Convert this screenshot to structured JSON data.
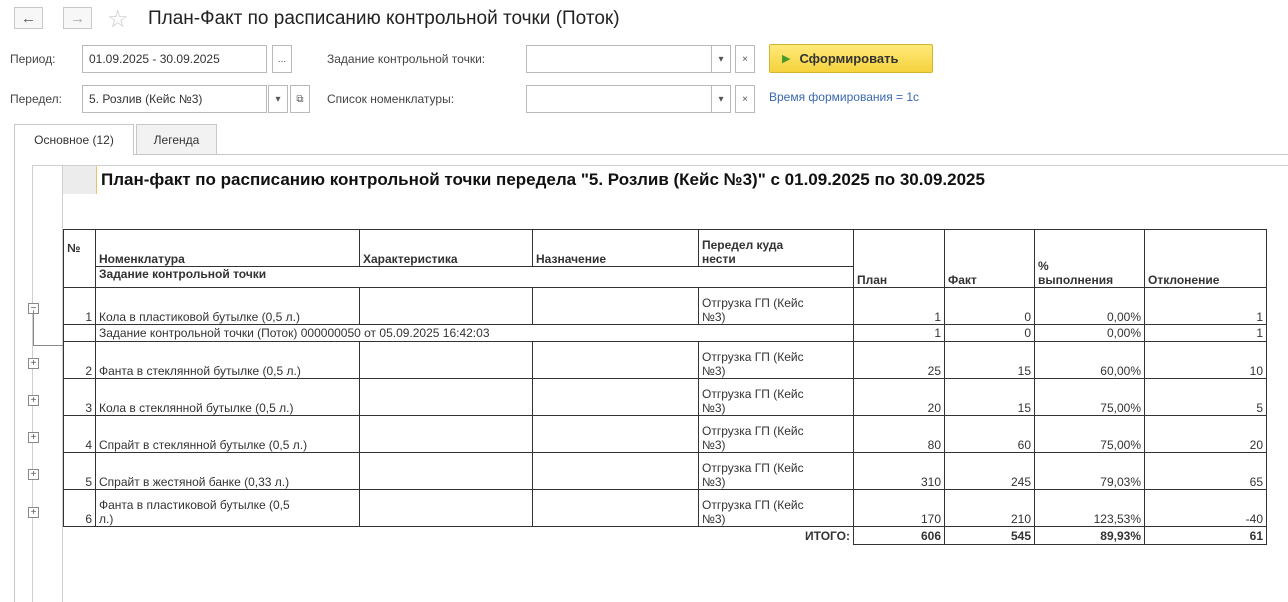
{
  "window": {
    "title": "План-Факт по расписанию контрольной точки (Поток)",
    "back_icon": "←",
    "forward_icon": "→",
    "star_icon": "☆"
  },
  "form": {
    "period_label": "Период:",
    "period_value": "01.09.2025 - 30.09.2025",
    "period_button": "...",
    "task_label": "Задание контрольной точки:",
    "task_value": "",
    "generate_button": "Сформировать",
    "peredel_label": "Передел:",
    "peredel_value": "5. Розлив (Кейс №3)",
    "nomenclature_label": "Список номенклатуры:",
    "nomenclature_value": "",
    "time_info": "Время формирования = 1с",
    "dropdown_icon": "▾",
    "clear_icon": "×",
    "open_icon": "⧉"
  },
  "tabs": [
    {
      "label": "Основное (12)"
    },
    {
      "label": "Легенда"
    }
  ],
  "report": {
    "title": "План-факт по расписанию контрольной точки передела \"5. Розлив (Кейс №3)\" с 01.09.2025 по 30.09.2025",
    "headers": {
      "num": "№",
      "nomenclature": "Номенклатура",
      "task": "Задание контрольной точки",
      "characteristic": "Характеристика",
      "purpose": "Назначение",
      "peredel_to_1": "Передел куда",
      "peredel_to_2": "нести",
      "plan": "План",
      "fact": "Факт",
      "percent_1": "%",
      "percent_2": "выполнения",
      "deviation": "Отклонение"
    },
    "rows": [
      {
        "num": "1",
        "name": "Кола в пластиковой бутылке (0,5 л.)",
        "dest1": "Отгрузка ГП (Кейс",
        "dest2": "№3)",
        "plan": "1",
        "fact": "0",
        "percent": "0,00%",
        "dev": "1"
      },
      {
        "num": "2",
        "name": "Фанта в стеклянной бутылке (0,5 л.)",
        "dest1": "Отгрузка ГП (Кейс",
        "dest2": "№3)",
        "plan": "25",
        "fact": "15",
        "percent": "60,00%",
        "dev": "10"
      },
      {
        "num": "3",
        "name": "Кола в стеклянной бутылке (0,5 л.)",
        "dest1": "Отгрузка ГП (Кейс",
        "dest2": "№3)",
        "plan": "20",
        "fact": "15",
        "percent": "75,00%",
        "dev": "5"
      },
      {
        "num": "4",
        "name": "Спрайт в стеклянной бутылке (0,5 л.)",
        "dest1": "Отгрузка ГП (Кейс",
        "dest2": "№3)",
        "plan": "80",
        "fact": "60",
        "percent": "75,00%",
        "dev": "20"
      },
      {
        "num": "5",
        "name": "Спрайт в жестяной банке (0,33 л.)",
        "dest1": "Отгрузка ГП (Кейс",
        "dest2": "№3)",
        "plan": "310",
        "fact": "245",
        "percent": "79,03%",
        "dev": "65"
      },
      {
        "num": "6",
        "name1": "Фанта в пластиковой бутылке (0,5",
        "name2": "л.)",
        "dest1": "Отгрузка ГП (Кейс",
        "dest2": "№3)",
        "plan": "170",
        "fact": "210",
        "percent": "123,53%",
        "dev": "-40"
      }
    ],
    "subrow": {
      "text": "Задание контрольной точки (Поток) 000000050 от 05.09.2025 16:42:03",
      "plan": "1",
      "fact": "0",
      "percent": "0,00%",
      "dev": "1"
    },
    "total": {
      "label": "ИТОГО:",
      "plan": "606",
      "fact": "545",
      "percent": "89,93%",
      "dev": "61"
    },
    "expander_minus": "−",
    "expander_plus": "+"
  }
}
